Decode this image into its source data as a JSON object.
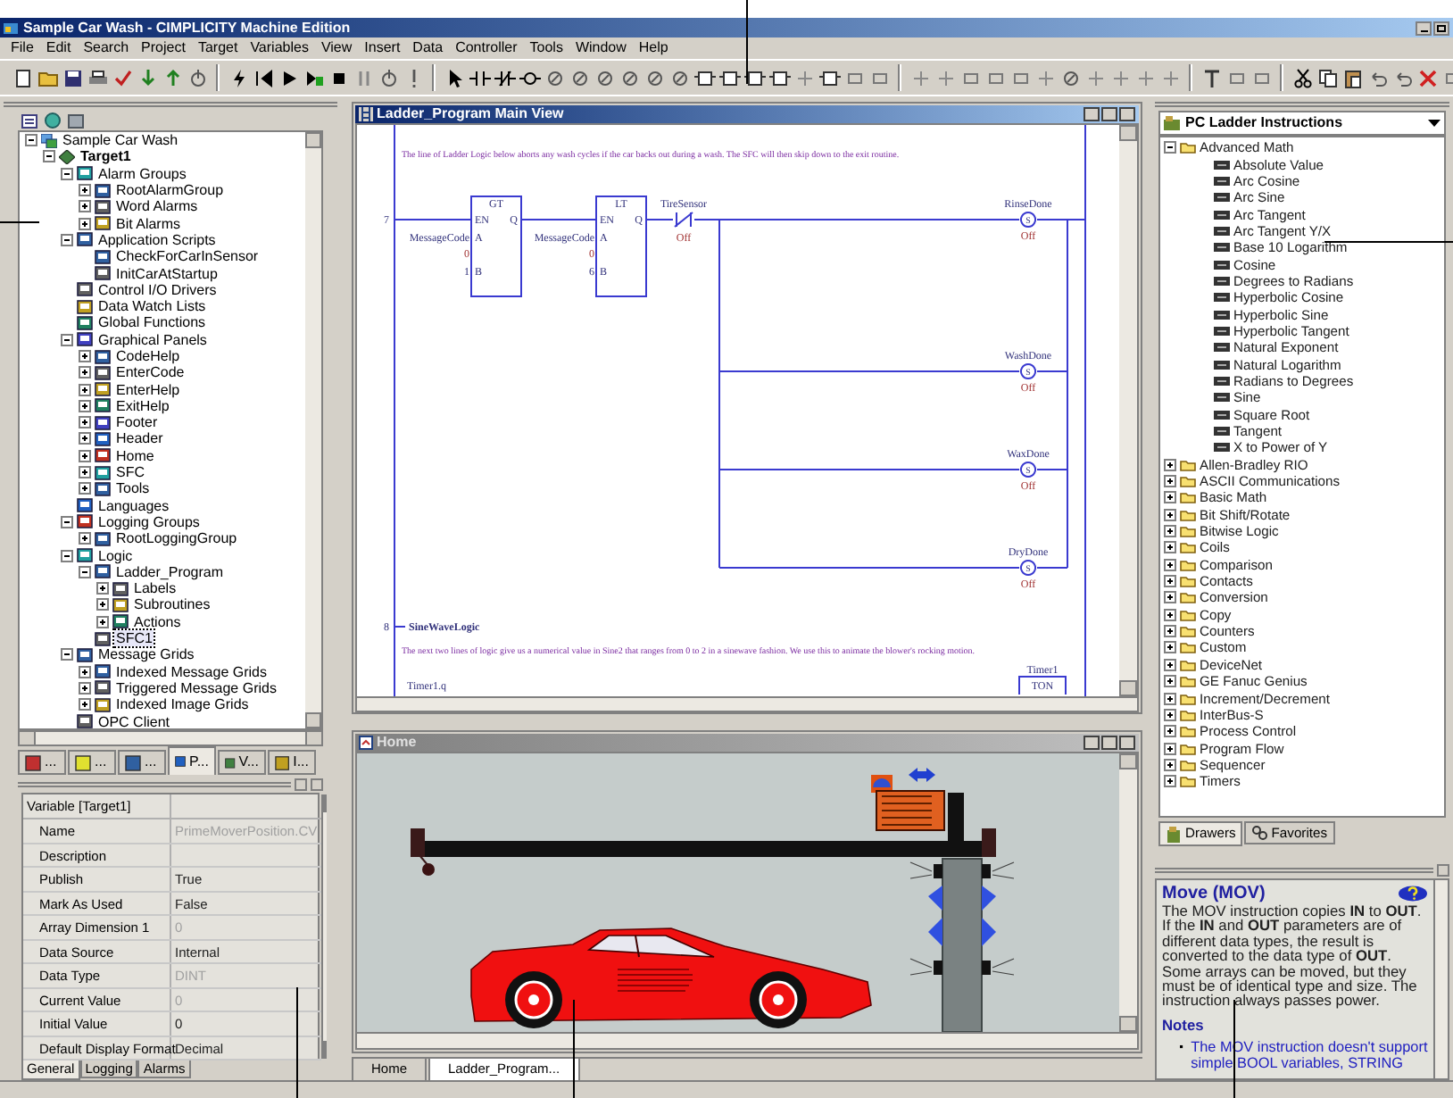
{
  "window": {
    "title": "Sample Car Wash - CIMPLICITY Machine Edition"
  },
  "menu": [
    "File",
    "Edit",
    "Search",
    "Project",
    "Target",
    "Variables",
    "View",
    "Insert",
    "Data",
    "Controller",
    "Tools",
    "Window",
    "Help"
  ],
  "project_tree": [
    {
      "label": "Sample Car Wash",
      "expanded": true,
      "selected": false,
      "children": [
        {
          "label": "Target1",
          "expanded": true,
          "selected": false,
          "children": [
            {
              "label": "Alarm Groups",
              "expanded": true,
              "selected": false,
              "children": [
                {
                  "label": "RootAlarmGroup",
                  "expanded": false,
                  "selected": false
                },
                {
                  "label": "Word Alarms",
                  "expanded": false,
                  "selected": false
                },
                {
                  "label": "Bit Alarms",
                  "expanded": false,
                  "selected": false
                }
              ]
            },
            {
              "label": "Application Scripts",
              "expanded": true,
              "selected": false,
              "children": [
                {
                  "label": "CheckForCarInSensor",
                  "selected": false
                },
                {
                  "label": "InitCarAtStartup",
                  "selected": false
                }
              ]
            },
            {
              "label": "Control I/O Drivers",
              "selected": false
            },
            {
              "label": "Data Watch Lists",
              "selected": false
            },
            {
              "label": "Global Functions",
              "selected": false
            },
            {
              "label": "Graphical Panels",
              "expanded": true,
              "selected": false,
              "children": [
                {
                  "label": "CodeHelp",
                  "expanded": false,
                  "selected": false
                },
                {
                  "label": "EnterCode",
                  "expanded": false,
                  "selected": false
                },
                {
                  "label": "EnterHelp",
                  "expanded": false,
                  "selected": false
                },
                {
                  "label": "ExitHelp",
                  "expanded": false,
                  "selected": false
                },
                {
                  "label": "Footer",
                  "expanded": false,
                  "selected": false
                },
                {
                  "label": "Header",
                  "expanded": false,
                  "selected": false
                },
                {
                  "label": "Home",
                  "expanded": false,
                  "selected": false
                },
                {
                  "label": "SFC",
                  "expanded": false,
                  "selected": false
                },
                {
                  "label": "Tools",
                  "expanded": false,
                  "selected": false
                }
              ]
            },
            {
              "label": "Languages",
              "selected": false
            },
            {
              "label": "Logging Groups",
              "expanded": true,
              "selected": false,
              "children": [
                {
                  "label": "RootLoggingGroup",
                  "expanded": false,
                  "selected": false
                }
              ]
            },
            {
              "label": "Logic",
              "expanded": true,
              "selected": false,
              "children": [
                {
                  "label": "Ladder_Program",
                  "expanded": true,
                  "selected": false,
                  "children": [
                    {
                      "label": "Labels",
                      "expanded": false,
                      "selected": false
                    },
                    {
                      "label": "Subroutines",
                      "expanded": false,
                      "selected": false
                    },
                    {
                      "label": "Actions",
                      "expanded": false,
                      "selected": false
                    }
                  ]
                },
                {
                  "label": "SFC1",
                  "selected": true
                }
              ]
            },
            {
              "label": "Message Grids",
              "expanded": true,
              "selected": false,
              "children": [
                {
                  "label": "Indexed Message Grids",
                  "expanded": false,
                  "selected": false
                },
                {
                  "label": "Triggered Message Grids",
                  "expanded": false,
                  "selected": false
                },
                {
                  "label": "Indexed Image Grids",
                  "expanded": false,
                  "selected": false
                }
              ]
            },
            {
              "label": "OPC Client",
              "selected": false
            }
          ]
        }
      ]
    }
  ],
  "navigator_tabs": [
    {
      "label": "...",
      "selected": false
    },
    {
      "label": "...",
      "selected": false
    },
    {
      "label": "...",
      "selected": false
    },
    {
      "label": "P...",
      "selected": true
    },
    {
      "label": "V...",
      "selected": false
    },
    {
      "label": "I...",
      "selected": false
    }
  ],
  "properties": {
    "title": "Variable [Target1]",
    "rows": [
      {
        "name": "Name",
        "value": "PrimeMoverPosition.CV",
        "disabled": true
      },
      {
        "name": "Description",
        "disabled": false
      },
      {
        "name": "Publish",
        "value": "True",
        "disabled": false
      },
      {
        "name": "Mark As Used",
        "value": "False",
        "disabled": false
      },
      {
        "name": "Array Dimension 1",
        "value": "0",
        "disabled": true
      },
      {
        "name": "Data Source",
        "value": "Internal",
        "disabled": false
      },
      {
        "name": "Data Type",
        "value": "DINT",
        "disabled": true
      },
      {
        "name": "Current Value",
        "value": "0",
        "disabled": true
      },
      {
        "name": "Initial Value",
        "value": "0",
        "disabled": false
      },
      {
        "name": "Default Display Format",
        "value": "Decimal",
        "disabled": false
      }
    ]
  },
  "property_tabs": [
    {
      "label": "General",
      "selected": true
    },
    {
      "label": "Logging",
      "selected": false
    },
    {
      "label": "Alarms",
      "selected": false
    }
  ],
  "ladder_window": {
    "title": "Ladder_Program Main View",
    "rung_7": {
      "number": "7",
      "comment": "The line of Ladder Logic below aborts any wash cycles if the car backs out during a wash.  The SFC will then skip down to the exit routine.",
      "blocks": [
        {
          "op": "GT",
          "pins": [
            "EN",
            "Q",
            "A",
            "B"
          ],
          "a_operand": "MessageCode",
          "a_value": "0",
          "b_operand": "1"
        },
        {
          "op": "LT",
          "pins": [
            "EN",
            "Q",
            "A",
            "B"
          ],
          "a_operand": "MessageCode",
          "a_value": "0",
          "b_operand": "6"
        }
      ],
      "contact": {
        "name": "TireSensor",
        "state": "Off"
      },
      "coils": [
        {
          "name": "RinseDone",
          "mark": "S",
          "state": "Off"
        },
        {
          "name": "WashDone",
          "mark": "S",
          "state": "Off"
        },
        {
          "name": "WaxDone",
          "mark": "S",
          "state": "Off"
        },
        {
          "name": "DryDone",
          "mark": "S",
          "state": "Off"
        }
      ]
    },
    "rung_8": {
      "number": "8",
      "heading": "SineWaveLogic",
      "comment": "The next two lines of logic give us a numerical value in Sine2 that ranges from 0 to 2 in a sinewave fashion.  We use this to animate the blower's rocking motion.",
      "contact": "Timer1.q",
      "timer": {
        "name": "Timer1",
        "op": "TON"
      }
    }
  },
  "home_window": {
    "title": "Home"
  },
  "document_tabs": [
    {
      "label": "Home",
      "selected": false
    },
    {
      "label": "Ladder_Program...",
      "selected": true
    }
  ],
  "instructions": {
    "drawer": "PC Ladder Instructions",
    "tree": [
      {
        "label": "Advanced Math",
        "expanded": true,
        "children": [
          {
            "label": "Absolute Value"
          },
          {
            "label": "Arc Cosine"
          },
          {
            "label": "Arc Sine"
          },
          {
            "label": "Arc Tangent"
          },
          {
            "label": "Arc Tangent Y/X"
          },
          {
            "label": "Base 10 Logarithm"
          },
          {
            "label": "Cosine"
          },
          {
            "label": "Degrees to Radians"
          },
          {
            "label": "Hyperbolic Cosine"
          },
          {
            "label": "Hyperbolic Sine"
          },
          {
            "label": "Hyperbolic Tangent"
          },
          {
            "label": "Natural Exponent"
          },
          {
            "label": "Natural Logarithm"
          },
          {
            "label": "Radians to Degrees"
          },
          {
            "label": "Sine"
          },
          {
            "label": "Square Root"
          },
          {
            "label": "Tangent"
          },
          {
            "label": "X to Power of Y"
          }
        ]
      },
      {
        "label": "Allen-Bradley RIO",
        "expanded": false
      },
      {
        "label": "ASCII Communications",
        "expanded": false
      },
      {
        "label": "Basic Math",
        "expanded": false
      },
      {
        "label": "Bit Shift/Rotate",
        "expanded": false
      },
      {
        "label": "Bitwise Logic",
        "expanded": false
      },
      {
        "label": "Coils",
        "expanded": false
      },
      {
        "label": "Comparison",
        "expanded": false
      },
      {
        "label": "Contacts",
        "expanded": false
      },
      {
        "label": "Conversion",
        "expanded": false
      },
      {
        "label": "Copy",
        "expanded": false
      },
      {
        "label": "Counters",
        "expanded": false
      },
      {
        "label": "Custom",
        "expanded": false
      },
      {
        "label": "DeviceNet",
        "expanded": false
      },
      {
        "label": "GE Fanuc Genius",
        "expanded": false
      },
      {
        "label": "Increment/Decrement",
        "expanded": false
      },
      {
        "label": "InterBus-S",
        "expanded": false
      },
      {
        "label": "Process Control",
        "expanded": false
      },
      {
        "label": "Program Flow",
        "expanded": false
      },
      {
        "label": "Sequencer",
        "expanded": false
      },
      {
        "label": "Timers",
        "expanded": false
      }
    ]
  },
  "drawer_tabs": [
    {
      "label": "Drawers",
      "selected": true
    },
    {
      "label": "Favorites",
      "selected": false
    }
  ],
  "help": {
    "title": "Move (MOV)",
    "body": "The MOV instruction copies **IN** to **OUT**. If the **IN** and **OUT** parameters are of different data types, the result is converted to the data type of **OUT**. Some arrays can be moved, but they must be of identical type and size. The instruction always passes power.",
    "notes_heading": "Notes",
    "notes": [
      "The MOV instruction doesn't support simple BOOL variables, STRING"
    ]
  }
}
